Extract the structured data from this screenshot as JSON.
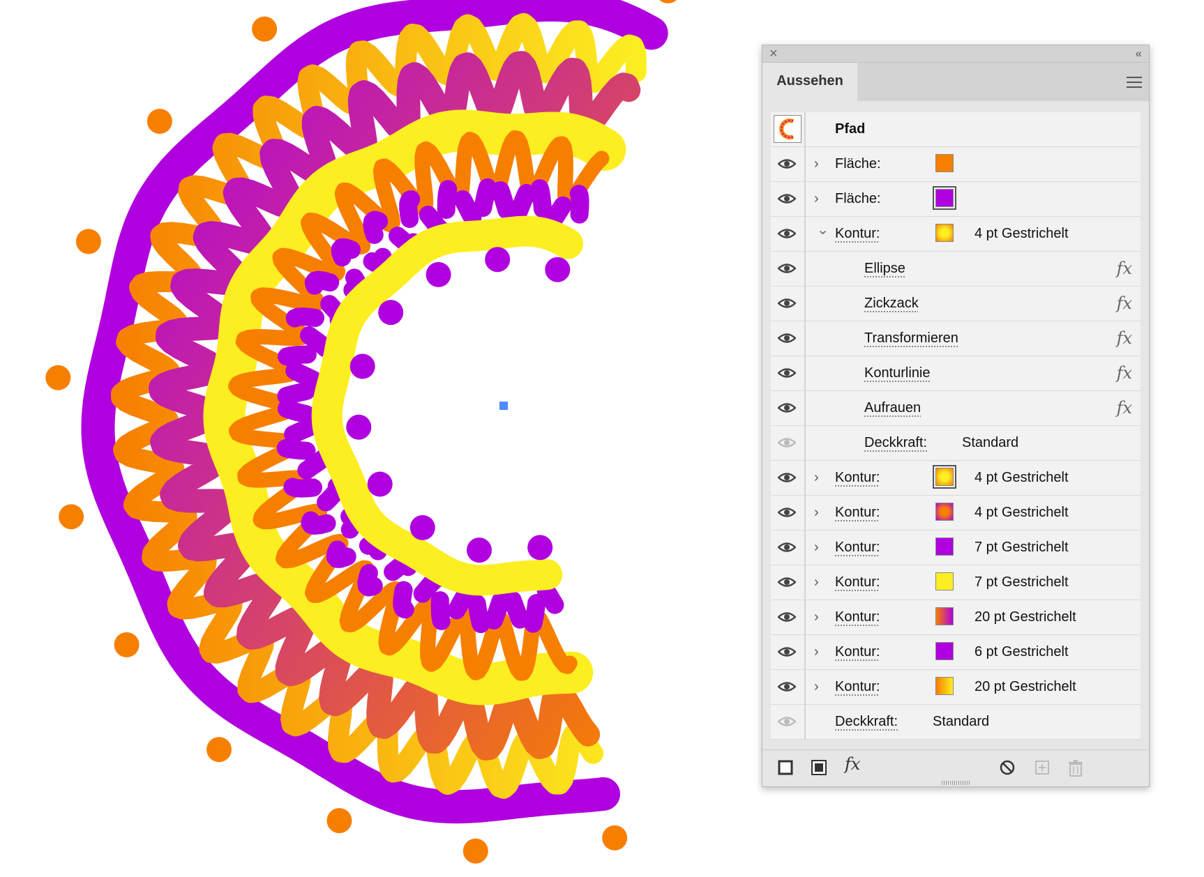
{
  "panel": {
    "title": "Aussehen",
    "object_label": "Pfad",
    "rows": [
      {
        "label": "Fläche:",
        "underline": false,
        "expand": "closed",
        "swatch": "orange",
        "value": "",
        "fx": false,
        "eye": true,
        "indent": false,
        "selected": false
      },
      {
        "label": "Fläche:",
        "underline": false,
        "expand": "closed",
        "swatch": "purple",
        "value": "",
        "fx": false,
        "eye": true,
        "indent": false,
        "selected": true
      },
      {
        "label": "Kontur:",
        "underline": true,
        "expand": "open",
        "swatch": "yellow-orange-radial",
        "value": "4 pt Gestrichelt",
        "fx": false,
        "eye": true,
        "indent": false,
        "selected": false
      },
      {
        "label": "Ellipse",
        "underline": true,
        "expand": "none",
        "swatch": "",
        "value": "",
        "fx": true,
        "eye": true,
        "indent": true,
        "selected": false
      },
      {
        "label": "Zickzack",
        "underline": true,
        "expand": "none",
        "swatch": "",
        "value": "",
        "fx": true,
        "eye": true,
        "indent": true,
        "selected": false
      },
      {
        "label": "Transformieren",
        "underline": true,
        "expand": "none",
        "swatch": "",
        "value": "",
        "fx": true,
        "eye": true,
        "indent": true,
        "selected": false
      },
      {
        "label": "Konturlinie",
        "underline": true,
        "expand": "none",
        "swatch": "",
        "value": "",
        "fx": true,
        "eye": true,
        "indent": true,
        "selected": false
      },
      {
        "label": "Aufrauen",
        "underline": true,
        "expand": "none",
        "swatch": "",
        "value": "",
        "fx": true,
        "eye": true,
        "indent": true,
        "selected": false
      },
      {
        "label": "Deckkraft:",
        "underline": true,
        "expand": "none",
        "swatch": "",
        "value": "Standard",
        "fx": false,
        "eye": false,
        "indent": true,
        "selected": false
      },
      {
        "label": "Kontur:",
        "underline": true,
        "expand": "closed",
        "swatch": "yellow-orange-radial",
        "value": "4 pt Gestrichelt",
        "fx": false,
        "eye": true,
        "indent": false,
        "selected": true
      },
      {
        "label": "Kontur:",
        "underline": true,
        "expand": "closed",
        "swatch": "orange-purple-radial",
        "value": "4 pt Gestrichelt",
        "fx": false,
        "eye": true,
        "indent": false,
        "selected": false
      },
      {
        "label": "Kontur:",
        "underline": true,
        "expand": "closed",
        "swatch": "purple",
        "value": "7 pt Gestrichelt",
        "fx": false,
        "eye": true,
        "indent": false,
        "selected": false
      },
      {
        "label": "Kontur:",
        "underline": true,
        "expand": "closed",
        "swatch": "yellow",
        "value": "7 pt Gestrichelt",
        "fx": false,
        "eye": true,
        "indent": false,
        "selected": false
      },
      {
        "label": "Kontur:",
        "underline": true,
        "expand": "closed",
        "swatch": "orange-purple-linear",
        "value": "20 pt Gestrichelt",
        "fx": false,
        "eye": true,
        "indent": false,
        "selected": false
      },
      {
        "label": "Kontur:",
        "underline": true,
        "expand": "closed",
        "swatch": "purple",
        "value": "6 pt Gestrichelt",
        "fx": false,
        "eye": true,
        "indent": false,
        "selected": false
      },
      {
        "label": "Kontur:",
        "underline": true,
        "expand": "closed",
        "swatch": "orange-yellow-linear",
        "value": "20 pt Gestrichelt",
        "fx": false,
        "eye": true,
        "indent": false,
        "selected": false
      },
      {
        "label": "Deckkraft:",
        "underline": true,
        "expand": "none",
        "swatch": "",
        "value": "Standard",
        "fx": false,
        "eye": false,
        "indent": false,
        "selected": false
      }
    ],
    "fx_symbol": "fx"
  },
  "colors": {
    "purple": "#b000e0",
    "orange": "#f77f00",
    "yellow": "#fcee21",
    "anchor_blue": "#4a8cff",
    "panel_bg": "#e6e6e6",
    "row_bg": "#f2f2f2"
  },
  "icons": [
    "close-icon",
    "collapse-icon",
    "panel-menu-icon",
    "visibility-eye-icon",
    "chevron-right-icon",
    "chevron-down-icon",
    "fx-icon",
    "add-stroke-icon",
    "add-fill-icon",
    "add-effect-icon",
    "clear-appearance-icon",
    "duplicate-item-icon",
    "delete-item-icon"
  ]
}
